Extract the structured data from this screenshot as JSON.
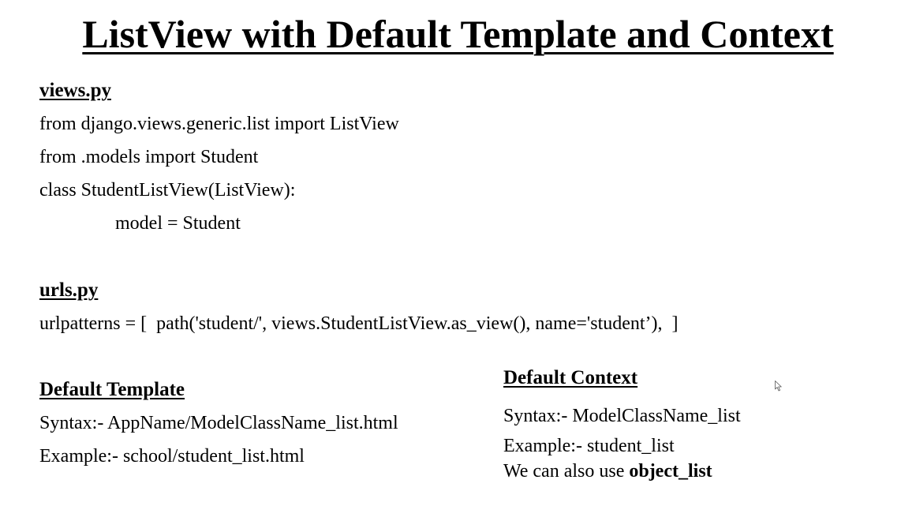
{
  "title": "ListView with Default Template and Context",
  "views": {
    "heading": "views.py",
    "lines": [
      "from django.views.generic.list import ListView",
      "from .models import Student",
      "class StudentListView(ListView):",
      "model = Student"
    ]
  },
  "urls": {
    "heading": "urls.py",
    "line": "urlpatterns = [  path('student/', views.StudentListView.as_view(), name='student’),  ]"
  },
  "default_template": {
    "heading": "Default Template",
    "syntax": "Syntax:- AppName/ModelClassName_list.html",
    "example": "Example:- school/student_list.html"
  },
  "default_context": {
    "heading": "Default Context",
    "syntax": "Syntax:- ModelClassName_list",
    "example": "Example:- student_list",
    "also_prefix": "We can also use ",
    "also_bold": "object_list"
  }
}
